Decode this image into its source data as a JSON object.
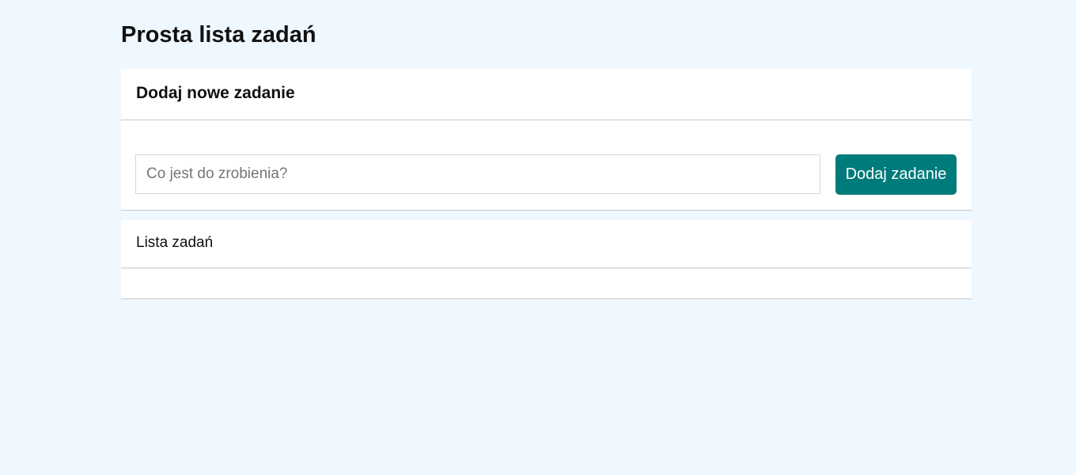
{
  "page": {
    "title": "Prosta lista zadań"
  },
  "add_section": {
    "title": "Dodaj nowe zadanie",
    "input_value": "",
    "input_placeholder": "Co jest do zrobienia?",
    "button_label": "Dodaj zadanie"
  },
  "list_section": {
    "title": "Lista zadań",
    "items": []
  },
  "colors": {
    "background": "#eff7ff",
    "card": "#ffffff",
    "accent": "#007b7b",
    "border": "#c8c8c8"
  }
}
